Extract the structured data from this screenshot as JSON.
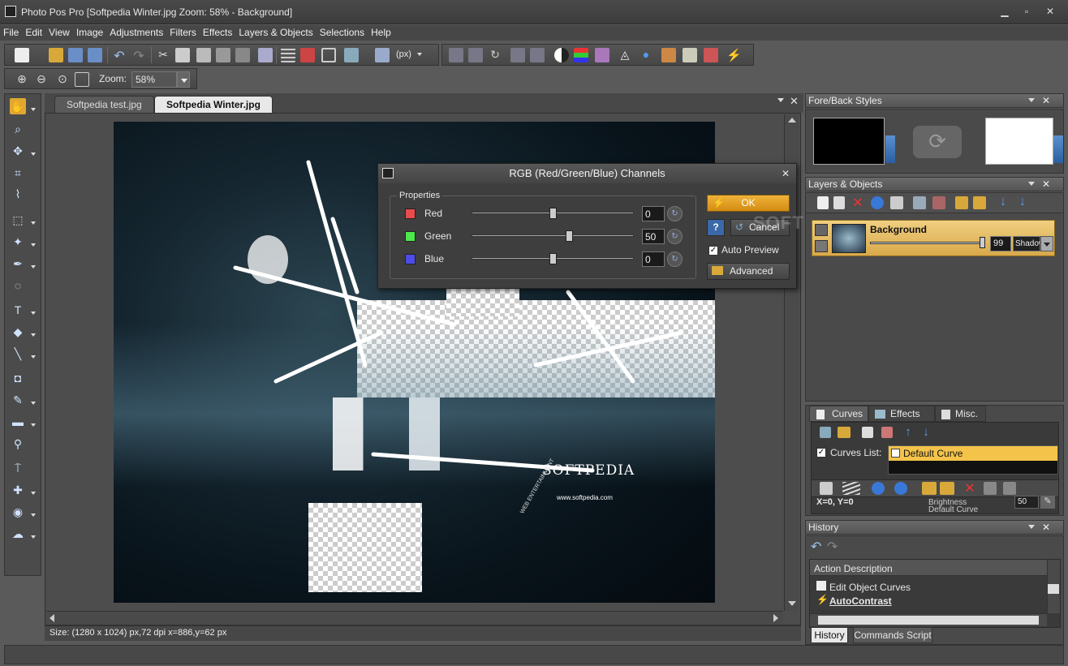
{
  "window": {
    "title": "Photo Pos Pro [Softpedia Winter.jpg Zoom: 58% - Background]"
  },
  "menu": [
    "File",
    "Edit",
    "View",
    "Image",
    "Adjustments",
    "Filters",
    "Effects",
    "Layers & Objects",
    "Selections",
    "Help"
  ],
  "toolbar": {
    "units_label": "(px)",
    "zoom_label": "Zoom:",
    "zoom_value": "58%"
  },
  "tabs": [
    {
      "label": "Softpedia test.jpg",
      "active": false
    },
    {
      "label": "Softpedia Winter.jpg",
      "active": true
    }
  ],
  "status": {
    "text": "Size: (1280 x 1024) px,72 dpi   x=886,y=62 px"
  },
  "dialog": {
    "title": "RGB (Red/Green/Blue) Channels",
    "group_label": "Properties",
    "channels": [
      {
        "name": "Red",
        "value": "0",
        "color": "#e84c4c",
        "slider": 0.5
      },
      {
        "name": "Green",
        "value": "50",
        "color": "#4ce84c",
        "slider": 0.6
      },
      {
        "name": "Blue",
        "value": "0",
        "color": "#4c4ce8",
        "slider": 0.5
      }
    ],
    "ok_label": "OK",
    "help_label": "?",
    "cancel_label": "Cancel",
    "auto_preview_label": "Auto Preview",
    "advanced_label": "Advanced"
  },
  "fore_back": {
    "title": "Fore/Back Styles",
    "fore_color": "#000000",
    "back_color": "#ffffff"
  },
  "layers": {
    "title": "Layers & Objects",
    "items": [
      {
        "name": "Background",
        "opacity": "99",
        "blend": "Shadow"
      }
    ]
  },
  "curves": {
    "tabs": [
      "Curves",
      "Effects",
      "Misc."
    ],
    "list_label": "Curves List:",
    "list_items": [
      "Default Curve"
    ],
    "coords": "X=0, Y=0",
    "brightness_label": "Brightness",
    "curve_label": "Default Curve",
    "value": "50"
  },
  "history": {
    "title": "History",
    "column_header": "Action Description",
    "items": [
      "Edit Object Curves",
      "AutoContrast"
    ],
    "tabs": [
      "History",
      "Commands Script"
    ]
  },
  "watermark": "SOFTPEDIA",
  "image_text": {
    "brand": "SOFTPEDIA",
    "url": "www.softpedia.com",
    "tag": "WEB ENTERTAINMENT"
  }
}
